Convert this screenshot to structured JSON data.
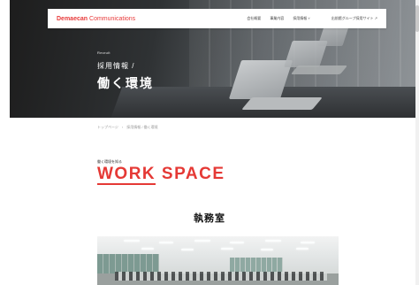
{
  "header": {
    "logo_main": "Demaecan",
    "logo_sub": "Communications",
    "nav": [
      {
        "label": "会社概要"
      },
      {
        "label": "事業内容"
      },
      {
        "label": "採用情報 ˅"
      },
      {
        "label": "出前館グループ採用サイト ↗"
      }
    ]
  },
  "hero": {
    "eyebrow": "Recruit",
    "crumbline": "採用情報 /",
    "title": "働く環境"
  },
  "breadcrumb": [
    "トップページ",
    "›",
    "採用情報 / 働く環境"
  ],
  "section": {
    "eyebrow": "働く環境を知る",
    "title_prefix": "WORK",
    "title_rest": " SPACE",
    "sub_heading": "執務室"
  },
  "colors": {
    "accent": "#e53935",
    "hero_dark": "#1d1d1d"
  }
}
